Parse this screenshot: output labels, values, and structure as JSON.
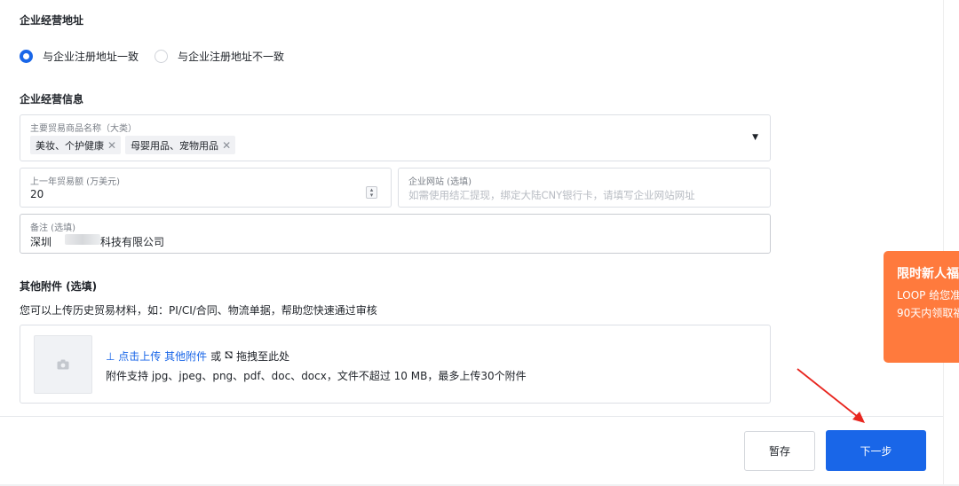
{
  "operating_address": {
    "title": "企业经营地址",
    "options": [
      {
        "label": "与企业注册地址一致",
        "checked": true
      },
      {
        "label": "与企业注册地址不一致",
        "checked": false
      }
    ]
  },
  "operating_info": {
    "title": "企业经营信息",
    "main_goods": {
      "label": "主要贸易商品名称（大类）",
      "tags": [
        "美妆、个护健康",
        "母婴用品、宠物用品"
      ],
      "caret": "▼"
    },
    "last_year_volume": {
      "label": "上一年贸易额 (万美元)",
      "value": "20"
    },
    "website": {
      "label": "企业网站 (选填)",
      "placeholder": "如需使用结汇提现，绑定大陆CNY银行卡，请填写企业网站网址"
    },
    "remark": {
      "label": "备注 (选填)",
      "value_prefix": "深圳",
      "value_suffix": "科技有限公司"
    }
  },
  "attachments": {
    "title": "其他附件 (选填)",
    "description": "您可以上传历史贸易材料，如：PI/CI/合同、物流单据，帮助您快速通过审核",
    "upload_link": "⊥ 点击上传 其他附件",
    "or_text": "或",
    "drag_icon": "⛞",
    "drag_text": "拖拽至此处",
    "hint": "附件支持 jpg、jpeg、png、pdf、doc、docx，文件不超过 10 MB，最多上传30个附件"
  },
  "footer": {
    "draft_label": "暂存",
    "next_label": "下一步"
  },
  "promo": {
    "title": "限时新人福",
    "line1": "LOOP 给您准",
    "line2": "90天内领取福"
  },
  "colors": {
    "accent": "#1966e8",
    "promo": "#ff7a3d",
    "annotation_arrow": "#e8261f"
  }
}
